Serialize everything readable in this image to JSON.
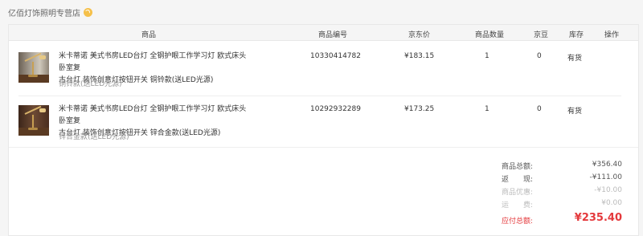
{
  "shop": {
    "name": "亿佰灯饰照明专营店",
    "badge_icon": "shop-badge-icon"
  },
  "columns": {
    "product": "商品",
    "sku": "商品编号",
    "price": "京东价",
    "qty": "商品数量",
    "beans": "京豆",
    "stock": "库存",
    "action": "操作"
  },
  "items": [
    {
      "name_line1": "米卡蒂诺 美式书房LED台灯 全钢护眼工作学习灯 欧式床头卧室复",
      "name_line2": "古台灯 装饰创意灯按钮开关 铜铃款(送LED光源)",
      "spec": "铜铃款(送LED光源)",
      "sku": "10330414782",
      "price": "¥183.15",
      "qty": "1",
      "beans": "0",
      "stock": "有货"
    },
    {
      "name_line1": "米卡蒂诺 美式书房LED台灯 全钢护眼工作学习灯 欧式床头卧室复",
      "name_line2": "古台灯 装饰创意灯按钮开关 锌合金款(送LED光源)",
      "spec": "锌合金款(送LED光源)",
      "sku": "10292932289",
      "price": "¥173.25",
      "qty": "1",
      "beans": "0",
      "stock": "有货"
    }
  ],
  "summary": {
    "subtotal_label": "商品总额:",
    "subtotal_value": "¥356.40",
    "rebate_label": "返　　现:",
    "rebate_value": "-¥111.00",
    "discount_label": "商品优惠:",
    "discount_value": "-¥10.00",
    "shipping_label": "运　　费:",
    "shipping_value": "¥0.00",
    "total_label": "应付总额:",
    "total_value": "¥235.40"
  },
  "colors": {
    "accent": "#e4393c",
    "badge": "#f5c04a"
  }
}
